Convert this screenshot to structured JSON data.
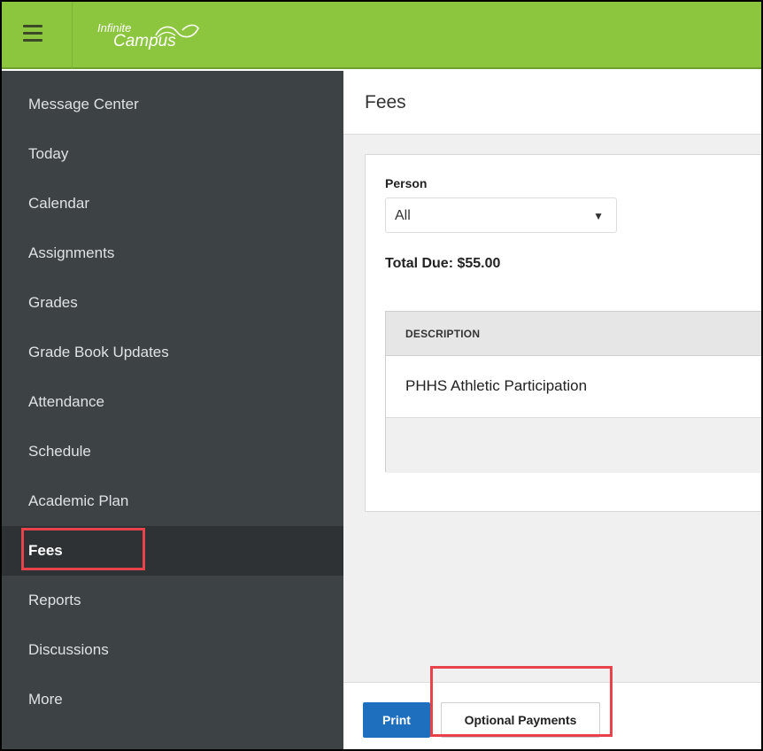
{
  "header": {
    "logo_top": "Infinite",
    "logo_bottom": "Campus",
    "brand_color": "#8cc63f"
  },
  "sidebar": {
    "items": [
      {
        "label": "Message Center"
      },
      {
        "label": "Today"
      },
      {
        "label": "Calendar"
      },
      {
        "label": "Assignments"
      },
      {
        "label": "Grades"
      },
      {
        "label": "Grade Book Updates"
      },
      {
        "label": "Attendance"
      },
      {
        "label": "Schedule"
      },
      {
        "label": "Academic Plan"
      },
      {
        "label": "Fees",
        "active": true
      },
      {
        "label": "Reports"
      },
      {
        "label": "Discussions"
      },
      {
        "label": "More"
      }
    ],
    "background": "#3d4245"
  },
  "main": {
    "title": "Fees",
    "person_label": "Person",
    "person_value": "All",
    "total_due": "Total Due: $55.00",
    "table": {
      "header": "DESCRIPTION",
      "rows": [
        {
          "description": "PHHS Athletic Participation"
        }
      ]
    },
    "buttons": {
      "print": "Print",
      "optional_payments": "Optional Payments"
    },
    "primary_color": "#1f6fbf"
  },
  "annotations": {
    "highlight_color": "#e8434a"
  }
}
